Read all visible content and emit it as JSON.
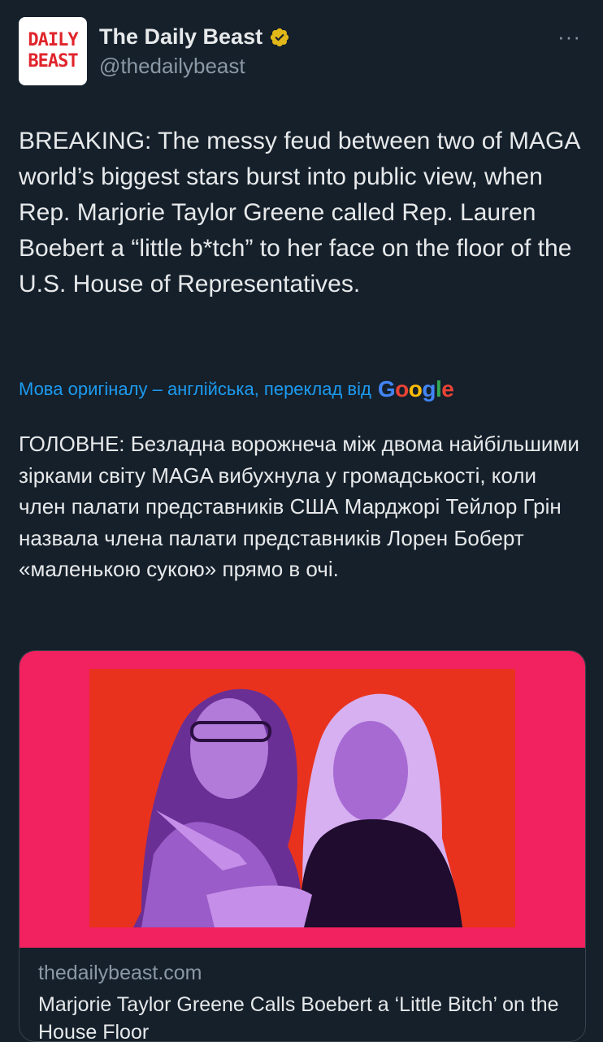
{
  "tweet": {
    "author": {
      "name": "The Daily Beast",
      "handle": "@thedailybeast",
      "avatar_text_line1": "DAILY",
      "avatar_text_line2": "BEAST"
    },
    "more_menu": "···",
    "text": "BREAKING: The messy feud between two of MAGA world’s biggest stars burst into public view, when Rep. Marjorie Taylor Greene called Rep. Lauren Boebert a “little b*tch” to her face on the floor of the U.S. House of Representatives.",
    "translation": {
      "notice": "Мова оригіналу – англійська, переклад від",
      "provider": "Google",
      "text": "ГОЛОВНЕ: Безладна ворожнеча між двома найбільшими зірками світу MAGA вибухнула у громадськості, коли член палати представників США Марджорі Тейлор Грін назвала члена палати представників Лорен Боберт «маленькою сукою» прямо в очі."
    },
    "link_card": {
      "domain": "thedailybeast.com",
      "title": "Marjorie Taylor Greene Calls Boebert a ‘Little Bitch’ on the House Floor"
    }
  },
  "colors": {
    "background": "#15202b",
    "link": "#1d9bf0",
    "muted": "#8b98a5",
    "verified": "#e2b719",
    "card_pink": "#f2215f",
    "card_red": "#e8321e",
    "photo_purple": "#9a5cc8"
  },
  "icons": {
    "verified": "verified-badge-icon",
    "more": "more-horizontal-icon"
  }
}
